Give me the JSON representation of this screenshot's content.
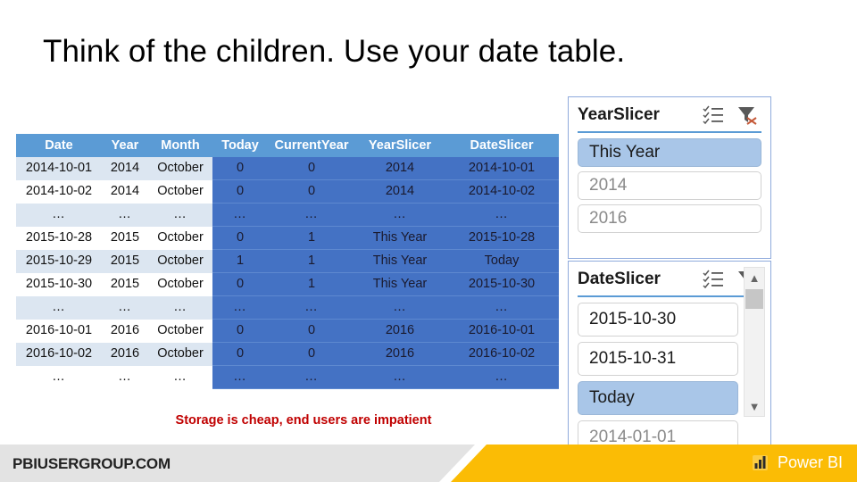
{
  "slide": {
    "title": "Think of the children. Use your date table.",
    "caption": "Storage is cheap, end users are impatient"
  },
  "table": {
    "headers": [
      "Date",
      "Year",
      "Month",
      "Today",
      "CurrentYear",
      "YearSlicer",
      "DateSlicer"
    ],
    "rows": [
      [
        "2014-10-01",
        "2014",
        "October",
        "0",
        "0",
        "2014",
        "2014-10-01"
      ],
      [
        "2014-10-02",
        "2014",
        "October",
        "0",
        "0",
        "2014",
        "2014-10-02"
      ],
      [
        "…",
        "…",
        "…",
        "…",
        "…",
        "…",
        "…"
      ],
      [
        "2015-10-28",
        "2015",
        "October",
        "0",
        "1",
        "This Year",
        "2015-10-28"
      ],
      [
        "2015-10-29",
        "2015",
        "October",
        "1",
        "1",
        "This Year",
        "Today"
      ],
      [
        "2015-10-30",
        "2015",
        "October",
        "0",
        "1",
        "This Year",
        "2015-10-30"
      ],
      [
        "…",
        "…",
        "…",
        "…",
        "…",
        "…",
        "…"
      ],
      [
        "2016-10-01",
        "2016",
        "October",
        "0",
        "0",
        "2016",
        "2016-10-01"
      ],
      [
        "2016-10-02",
        "2016",
        "October",
        "0",
        "0",
        "2016",
        "2016-10-02"
      ],
      [
        "…",
        "…",
        "…",
        "…",
        "…",
        "…",
        "…"
      ]
    ]
  },
  "year_slicer": {
    "title": "YearSlicer",
    "items": [
      {
        "label": "This Year",
        "selected": true
      },
      {
        "label": "2014",
        "selected": false
      },
      {
        "label": "2016",
        "selected": false
      }
    ]
  },
  "date_slicer": {
    "title": "DateSlicer",
    "items": [
      {
        "label": "2015-10-30",
        "selected": false
      },
      {
        "label": "2015-10-31",
        "selected": false
      },
      {
        "label": "Today",
        "selected": true
      },
      {
        "label": "2014-01-01",
        "selected": false
      }
    ]
  },
  "footer": {
    "site": "PBIUSERGROUP.COM",
    "product": "Power BI"
  },
  "colors": {
    "header_blue": "#5B9BD5",
    "cell_blue": "#4472C4",
    "stripe_light": "#DCE6F1",
    "selected_blue": "#A9C6E8",
    "caption_red": "#C00000",
    "footer_yellow": "#FBBC05",
    "footer_gray": "#E3E3E3"
  }
}
